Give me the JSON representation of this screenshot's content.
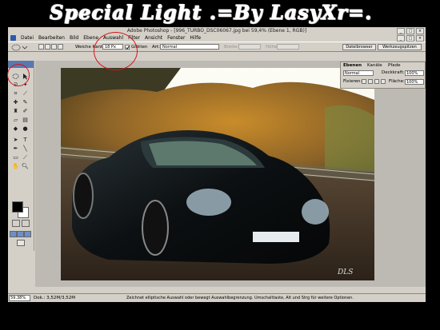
{
  "banner": {
    "title": "Special Light .=By LasyXr=."
  },
  "window": {
    "title": "Adobe Photoshop - [996_TURBO_DSC06067.jpg bei 59,4% (Ebene 1, RGB)]",
    "minimize": "_",
    "maximize": "□",
    "close": "×",
    "doc_min": "_",
    "doc_max": "□",
    "doc_close": "×"
  },
  "menu": [
    "Datei",
    "Bearbeiten",
    "Bild",
    "Ebene",
    "Auswahl",
    "Filter",
    "Ansicht",
    "Fenster",
    "Hilfe"
  ],
  "options": {
    "feather_label": "Weiche Kante:",
    "feather_value": "18 Px",
    "antialias_label": "Glätten",
    "style_label": "Art:",
    "style_value": "Normal",
    "width_label": "Breite:",
    "height_label": "Höhe:",
    "file_browser": "Dateibrowser",
    "tool_presets": "Werkzeugspitzen"
  },
  "layers_panel": {
    "tabs": [
      "Ebenen",
      "Kanäle",
      "Pfade"
    ],
    "blend_mode": "Normal",
    "opacity_label": "Deckkraft:",
    "opacity_value": "100%",
    "lock_label": "Fixieren:",
    "fill_label": "Fläche:",
    "fill_value": "100%"
  },
  "status": {
    "zoom": "59,38%",
    "doc": "Dok.: 3,52M/3,52M",
    "hint": "Zeichnet elliptische Auswahl oder bewegt Auswahlbegrenzung. Umschalttaste, Alt und Strg für weitere Optionen."
  },
  "photo": {
    "plate": "",
    "watermark": "DLS"
  },
  "colors": {
    "annotation": "#d4161b",
    "app_gray": "#d4d0c8"
  }
}
